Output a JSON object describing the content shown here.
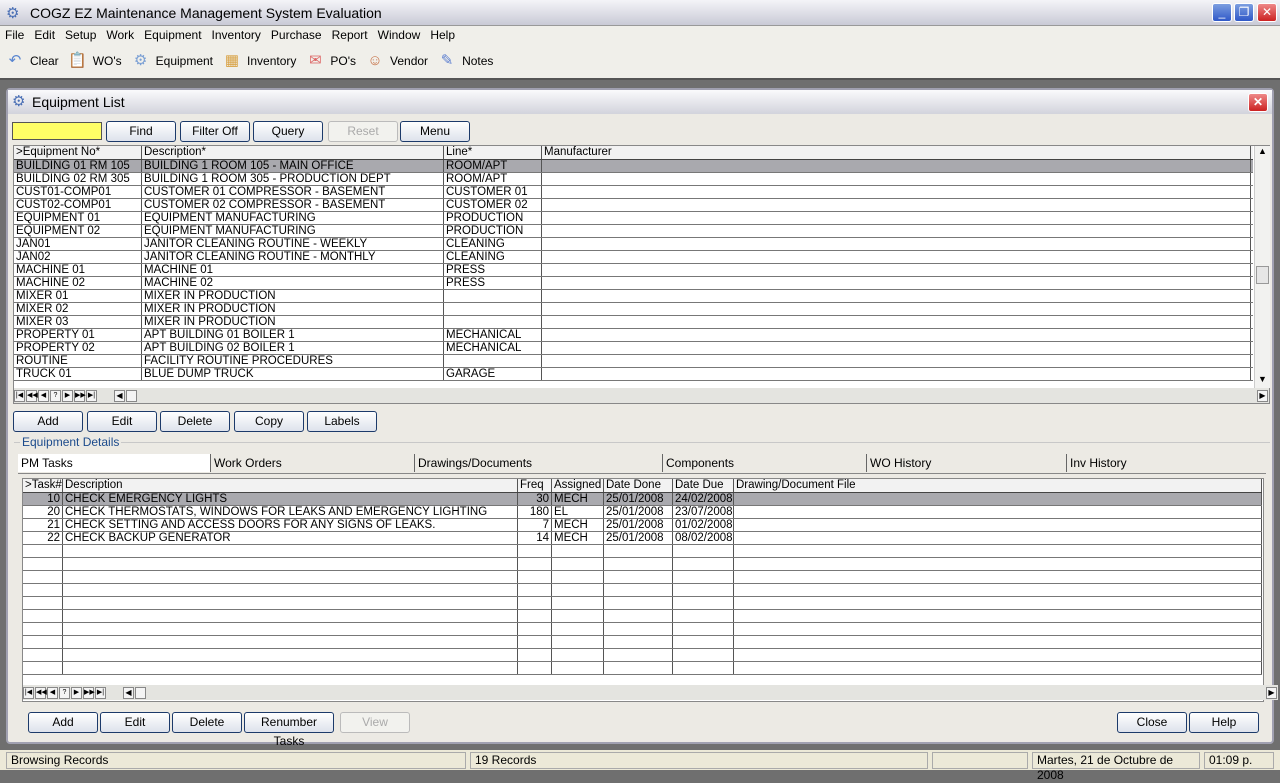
{
  "app": {
    "title": "COGZ EZ Maintenance Management System Evaluation"
  },
  "menu": [
    "File",
    "Edit",
    "Setup",
    "Work",
    "Equipment",
    "Inventory",
    "Purchase",
    "Report",
    "Window",
    "Help"
  ],
  "toolbar": [
    {
      "label": "Clear",
      "icon": "undo-arrow-icon"
    },
    {
      "label": "WO's",
      "icon": "clipboard-icon"
    },
    {
      "label": "Equipment",
      "icon": "gears-icon"
    },
    {
      "label": "Inventory",
      "icon": "box-icon"
    },
    {
      "label": "PO's",
      "icon": "purchase-order-icon"
    },
    {
      "label": "Vendor",
      "icon": "people-icon"
    },
    {
      "label": "Notes",
      "icon": "pen-icon"
    }
  ],
  "window": {
    "title": "Equipment List"
  },
  "search": {
    "value": "",
    "buttons": [
      "Find",
      "Filter Off",
      "Query",
      "Reset",
      "Menu"
    ]
  },
  "equipment": {
    "columns": [
      ">Equipment No*",
      "Description*",
      "Line*",
      "Manufacturer"
    ],
    "rows": [
      [
        "BUILDING 01 RM 105",
        "BUILDING 1 ROOM 105 - MAIN OFFICE",
        "ROOM/APT",
        ""
      ],
      [
        "BUILDING 02 RM 305",
        "BUILDING 1 ROOM 305 - PRODUCTION DEPT",
        "ROOM/APT",
        ""
      ],
      [
        "CUST01-COMP01",
        "CUSTOMER 01 COMPRESSOR - BASEMENT",
        "CUSTOMER 01",
        ""
      ],
      [
        "CUST02-COMP01",
        "CUSTOMER 02 COMPRESSOR - BASEMENT",
        "CUSTOMER 02",
        ""
      ],
      [
        "EQUIPMENT 01",
        "EQUIPMENT MANUFACTURING",
        "PRODUCTION",
        ""
      ],
      [
        "EQUIPMENT 02",
        "EQUIPMENT MANUFACTURING",
        "PRODUCTION",
        ""
      ],
      [
        "JAN01",
        "JANITOR CLEANING ROUTINE - WEEKLY",
        "CLEANING",
        ""
      ],
      [
        "JAN02",
        "JANITOR CLEANING ROUTINE - MONTHLY",
        "CLEANING",
        ""
      ],
      [
        "MACHINE 01",
        "MACHINE 01",
        "PRESS",
        ""
      ],
      [
        "MACHINE 02",
        "MACHINE 02",
        "PRESS",
        ""
      ],
      [
        "MIXER 01",
        "MIXER IN PRODUCTION",
        "",
        ""
      ],
      [
        "MIXER 02",
        "MIXER IN PRODUCTION",
        "",
        ""
      ],
      [
        "MIXER 03",
        "MIXER IN PRODUCTION",
        "",
        ""
      ],
      [
        "PROPERTY 01",
        "APT BUILDING 01 BOILER 1",
        "MECHANICAL",
        ""
      ],
      [
        "PROPERTY 02",
        "APT BUILDING 02 BOILER 1",
        "MECHANICAL",
        ""
      ],
      [
        "ROUTINE",
        "FACILITY ROUTINE PROCEDURES",
        "",
        ""
      ],
      [
        "TRUCK 01",
        "BLUE DUMP TRUCK",
        "GARAGE",
        ""
      ]
    ],
    "nav": [
      "|◀",
      "◀◀",
      "◀",
      "?",
      "▶",
      "▶▶",
      "▶|"
    ],
    "buttons": [
      "Add",
      "Edit",
      "Delete",
      "Copy",
      "Labels"
    ]
  },
  "details": {
    "group_label": "Equipment Details",
    "tabs": [
      "PM Tasks",
      "Work Orders",
      "Drawings/Documents",
      "Components",
      "WO History",
      "Inv History"
    ],
    "columns": [
      ">Task#",
      "Description",
      "Freq",
      "Assigned",
      "Date Done",
      "Date Due",
      "Drawing/Document File"
    ],
    "rows": [
      [
        "10",
        "CHECK EMERGENCY LIGHTS",
        "30",
        "MECH",
        "25/01/2008",
        "24/02/2008",
        ""
      ],
      [
        "20",
        "CHECK THERMOSTATS, WINDOWS FOR LEAKS AND EMERGENCY LIGHTING",
        "180",
        "EL",
        "25/01/2008",
        "23/07/2008",
        ""
      ],
      [
        "21",
        "CHECK SETTING AND ACCESS DOORS FOR ANY SIGNS OF LEAKS.",
        "7",
        "MECH",
        "25/01/2008",
        "01/02/2008",
        ""
      ],
      [
        "22",
        "CHECK BACKUP GENERATOR",
        "14",
        "MECH",
        "25/01/2008",
        "08/02/2008",
        ""
      ]
    ],
    "buttons": [
      "Add",
      "Edit",
      "Delete",
      "Renumber Tasks",
      "View"
    ],
    "right_buttons": [
      "Close",
      "Help"
    ]
  },
  "status": {
    "mode": "Browsing Records",
    "records": "19 Records",
    "extra": "",
    "date": "Martes, 21 de Octubre de 2008",
    "time": "01:09 p."
  }
}
